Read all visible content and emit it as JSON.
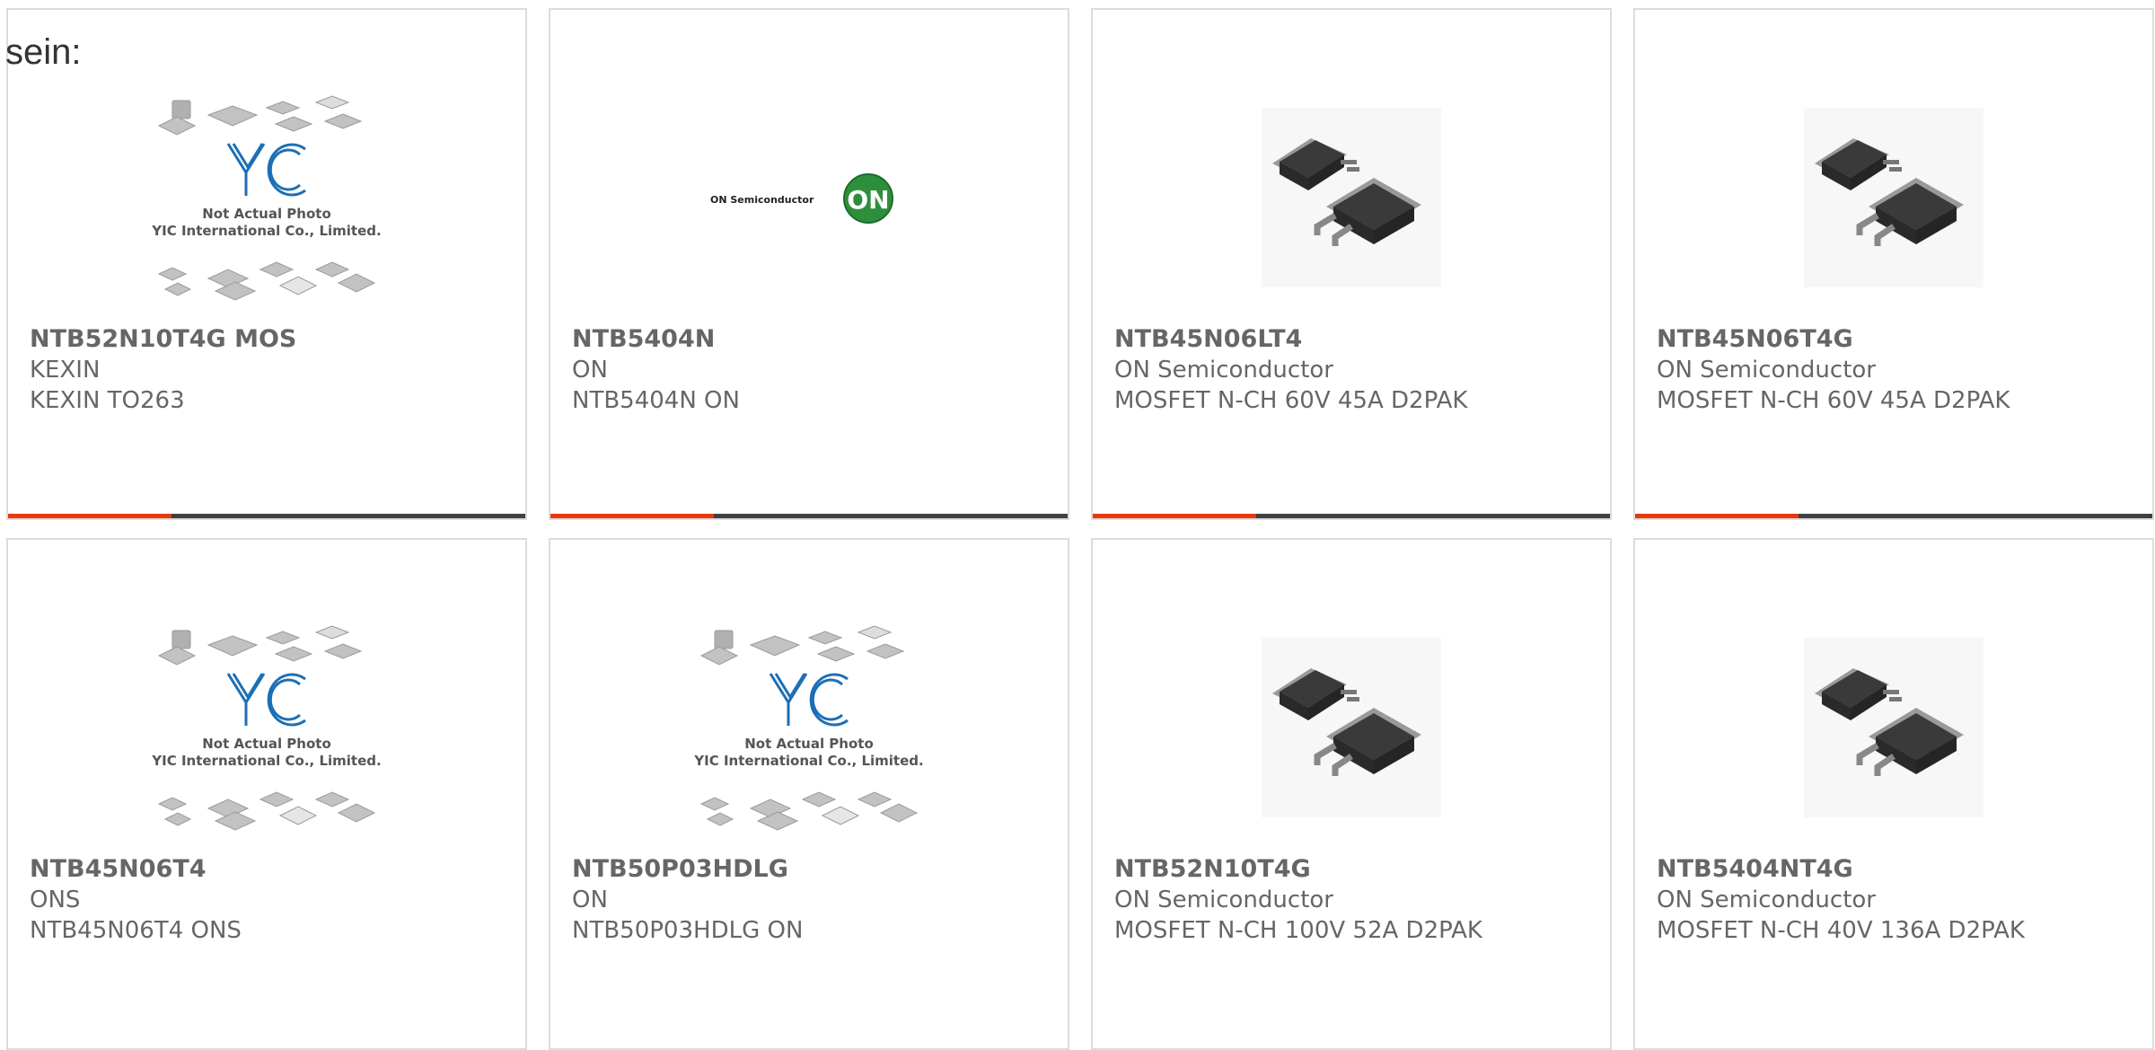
{
  "intro_text": "sein:",
  "brand": {
    "accent": "#e8380d",
    "bar": "#404040",
    "border": "#dcdcdc"
  },
  "placeholder": {
    "caption1": "Not Actual Photo",
    "caption2": "YIC International Co., Limited.",
    "logo": "YIC"
  },
  "on_logo": {
    "text": "ON Semiconductor",
    "badge": "ON"
  },
  "products": [
    {
      "name": "NTB52N10T4G MOS",
      "maker": "KEXIN",
      "desc": "KEXIN TO263",
      "image": "yic-placeholder-icon"
    },
    {
      "name": "NTB5404N",
      "maker": "ON",
      "desc": "NTB5404N ON",
      "image": "on-semiconductor-logo"
    },
    {
      "name": "NTB45N06LT4",
      "maker": "ON Semiconductor",
      "desc": "MOSFET N-CH 60V 45A D2PAK",
      "image": "d2pak-package-icon"
    },
    {
      "name": "NTB45N06T4G",
      "maker": "ON Semiconductor",
      "desc": "MOSFET N-CH 60V 45A D2PAK",
      "image": "d2pak-package-icon"
    },
    {
      "name": "NTB45N06T4",
      "maker": "ONS",
      "desc": "NTB45N06T4 ONS",
      "image": "yic-placeholder-icon"
    },
    {
      "name": "NTB50P03HDLG",
      "maker": "ON",
      "desc": "NTB50P03HDLG ON",
      "image": "yic-placeholder-icon"
    },
    {
      "name": "NTB52N10T4G",
      "maker": "ON Semiconductor",
      "desc": "MOSFET N-CH 100V 52A D2PAK",
      "image": "d2pak-package-icon"
    },
    {
      "name": "NTB5404NT4G",
      "maker": "ON Semiconductor",
      "desc": "MOSFET N-CH 40V 136A D2PAK",
      "image": "d2pak-package-icon"
    }
  ]
}
